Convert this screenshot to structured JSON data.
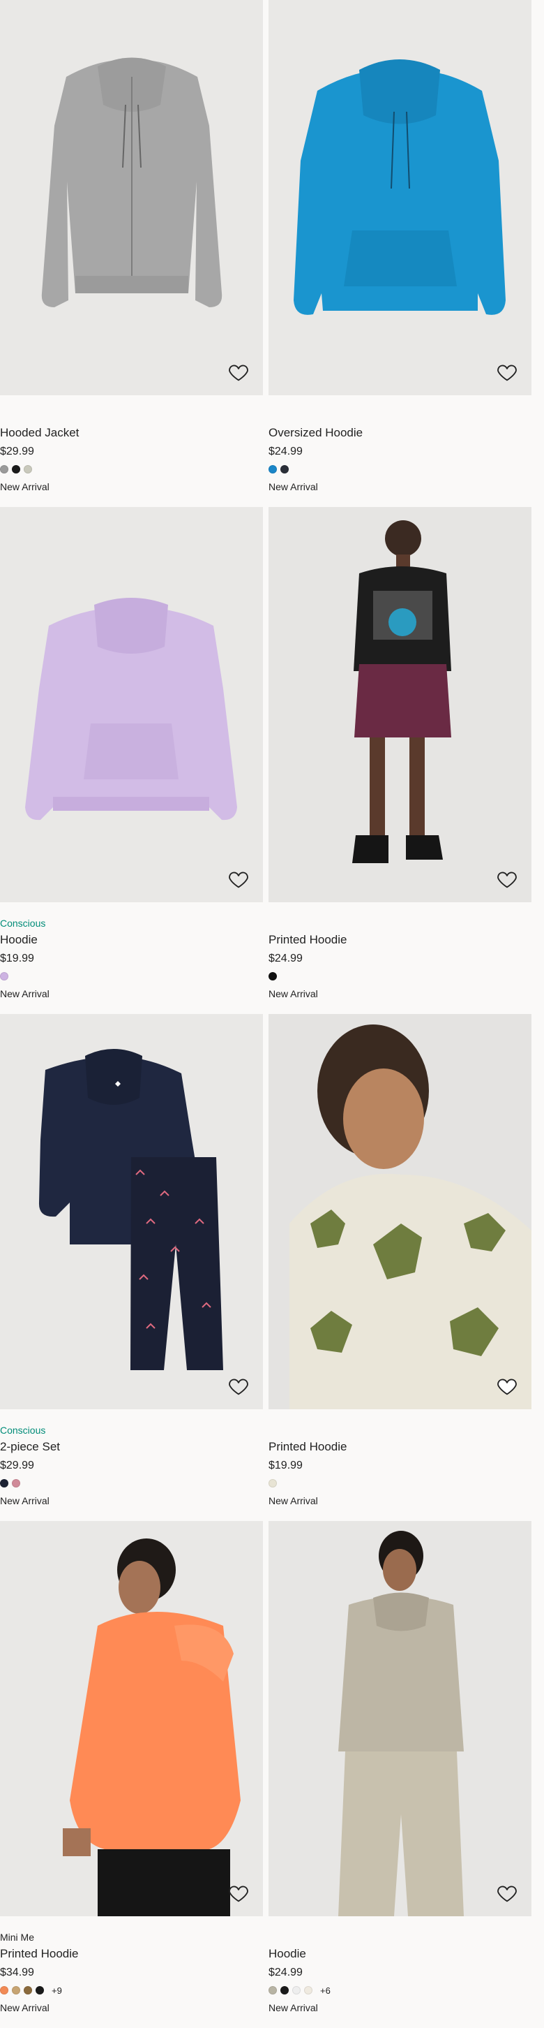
{
  "products": [
    {
      "tag": "",
      "name": "Hooded Jacket",
      "price": "$29.99",
      "swatches": [
        "#9a9a9a",
        "#1a1a1a",
        "#c9c9bc"
      ],
      "more": "",
      "badge": "New Arrival",
      "bg": "#e9e8e6",
      "icon": "heart-icon"
    },
    {
      "tag": "",
      "name": "Oversized Hoodie",
      "price": "$24.99",
      "swatches": [
        "#1a86c8",
        "#2a2f38"
      ],
      "more": "",
      "badge": "New Arrival",
      "bg": "#e9e8e6",
      "icon": "heart-icon"
    },
    {
      "tag": "Conscious",
      "name": "Hoodie",
      "price": "$19.99",
      "swatches": [
        "#cdb3e2"
      ],
      "more": "",
      "badge": "New Arrival",
      "bg": "#e9e8e6",
      "icon": "heart-icon"
    },
    {
      "tag": "",
      "name": "Printed Hoodie",
      "price": "$24.99",
      "swatches": [
        "#111111"
      ],
      "more": "",
      "badge": "New Arrival",
      "bg": "#e6e5e3",
      "icon": "heart-icon"
    },
    {
      "tag": "Conscious",
      "name": "2-piece Set",
      "price": "$29.99",
      "swatches": [
        "#1c2233",
        "#d08a98"
      ],
      "more": "",
      "badge": "New Arrival",
      "bg": "#e9e8e6",
      "icon": "heart-icon"
    },
    {
      "tag": "",
      "name": "Printed Hoodie",
      "price": "$19.99",
      "swatches": [
        "#e8e4d4"
      ],
      "more": "",
      "badge": "New Arrival",
      "bg": "#e4e3e1",
      "icon": "heart-icon"
    },
    {
      "tag": "Mini Me",
      "name": "Printed Hoodie",
      "price": "$34.99",
      "swatches": [
        "#f28a55",
        "#c7a472",
        "#8a6a3c",
        "#1a1a1a"
      ],
      "more": "+9",
      "badge": "New Arrival",
      "bg": "#e9e8e6",
      "icon": "heart-icon"
    },
    {
      "tag": "",
      "name": "Hoodie",
      "price": "$24.99",
      "swatches": [
        "#b8b4a4",
        "#1a1a1a",
        "#eeeeee",
        "#efeae0"
      ],
      "more": "+6",
      "badge": "New Arrival",
      "bg": "#e7e6e4",
      "icon": "heart-icon"
    }
  ]
}
